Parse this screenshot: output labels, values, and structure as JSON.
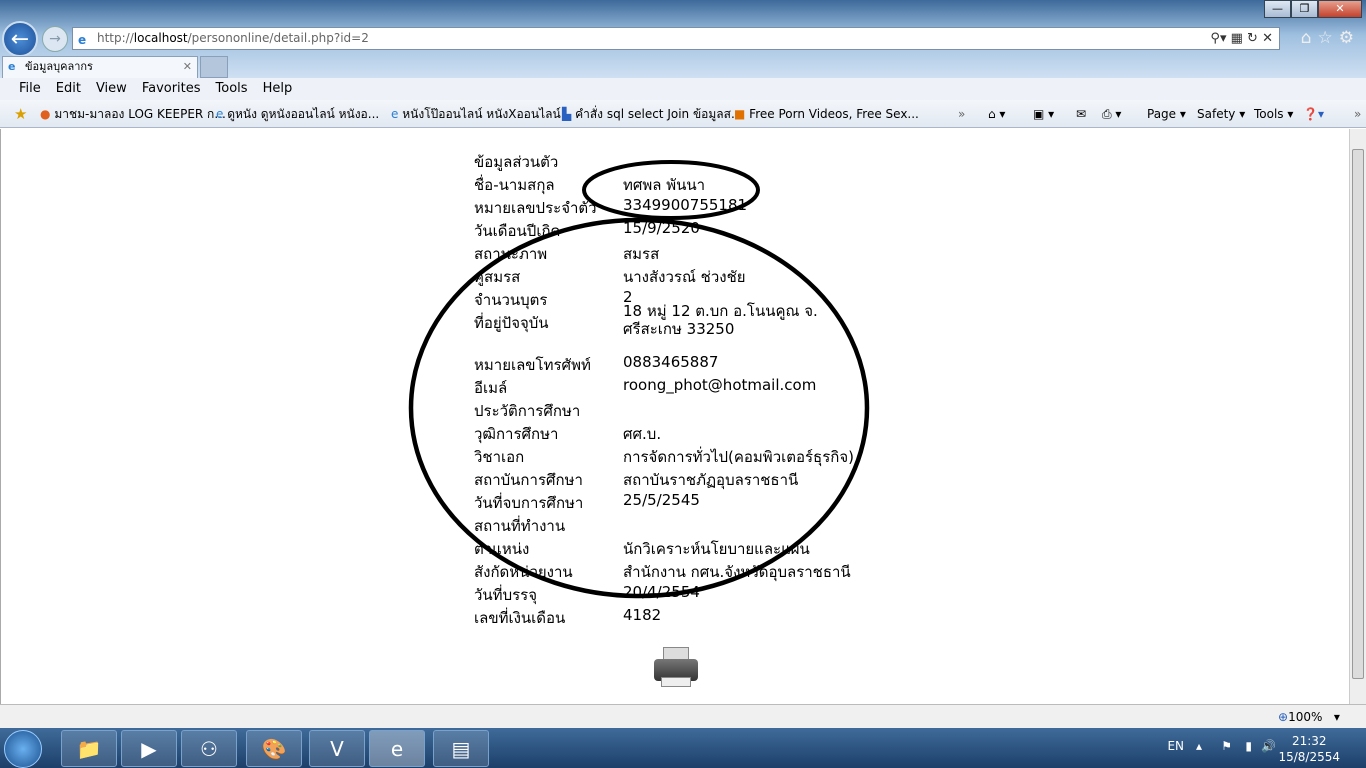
{
  "browser": {
    "url_prefix": "http://",
    "url_host": "localhost",
    "url_path": "/persononline/detail.php?id=2",
    "tab_title": "ข้อมูลบุคลากร",
    "menu": [
      "File",
      "Edit",
      "View",
      "Favorites",
      "Tools",
      "Help"
    ],
    "favorites": [
      "มาชม-มาลอง LOG KEEPER ก...",
      "ดูหนัง ดูหนังออนไลน์ หนังอ...",
      "หนังโป๊ออนไลน์ หนังXออนไลน์",
      "คำสั่ง sql select Join ข้อมูลส...",
      "Free Porn Videos, Free Sex..."
    ],
    "command_bar": {
      "page": "Page",
      "safety": "Safety",
      "tools": "Tools"
    },
    "zoom": "100%"
  },
  "page": {
    "section_personal": "ข้อมูลส่วนตัว",
    "rows": [
      {
        "label": "ชื่อ-นามสกุล",
        "value": "ทศพล  พันนา"
      },
      {
        "label": "หมายเลขประจำตัว",
        "value": "3349900755181"
      },
      {
        "label": "วันเดือนปีเกิด",
        "value": "15/9/2520"
      },
      {
        "label": "สถานะภาพ",
        "value": "สมรส"
      },
      {
        "label": "คู่สมรส",
        "value": "นางสังวรณ์ ช่วงชัย"
      },
      {
        "label": "จำนวนบุตร",
        "value": "2"
      },
      {
        "label": "ที่อยู่ปัจจุบัน",
        "value": "18 หมู่ 12 ต.บก อ.โนนคูณ จ.",
        "value2": "ศรีสะเกษ 33250"
      },
      {
        "label": "หมายเลขโทรศัพท์",
        "value": "0883465887"
      },
      {
        "label": "อีเมล์",
        "value": "roong_phot@hotmail.com"
      },
      {
        "label": "ประวัติการศึกษา",
        "value": ""
      },
      {
        "label": "วุฒิการศึกษา",
        "value": "ศศ.บ."
      },
      {
        "label": "วิชาเอก",
        "value": "การจัดการทั่วไป(คอมพิวเตอร์ธุรกิจ)"
      },
      {
        "label": "สถาบันการศึกษา",
        "value": "สถาบันราชภัฏอุบลราชธานี"
      },
      {
        "label": "วันที่จบการศึกษา",
        "value": "25/5/2545"
      },
      {
        "label": "สถานที่ทำงาน",
        "value": ""
      },
      {
        "label": "ตำแหน่ง",
        "value": "นักวิเคราะห์นโยบายและแผน"
      },
      {
        "label": "สังกัดหน่วยงาน",
        "value": "สำนักงาน กศน.จังหวัดอุบลราชธานี"
      },
      {
        "label": "วันที่บรรจุ",
        "value": "20/4/2554"
      },
      {
        "label": "เลขที่เงินเดือน",
        "value": "4182"
      }
    ]
  },
  "taskbar": {
    "lang": "EN",
    "time": "21:32",
    "date": "15/8/2554"
  }
}
